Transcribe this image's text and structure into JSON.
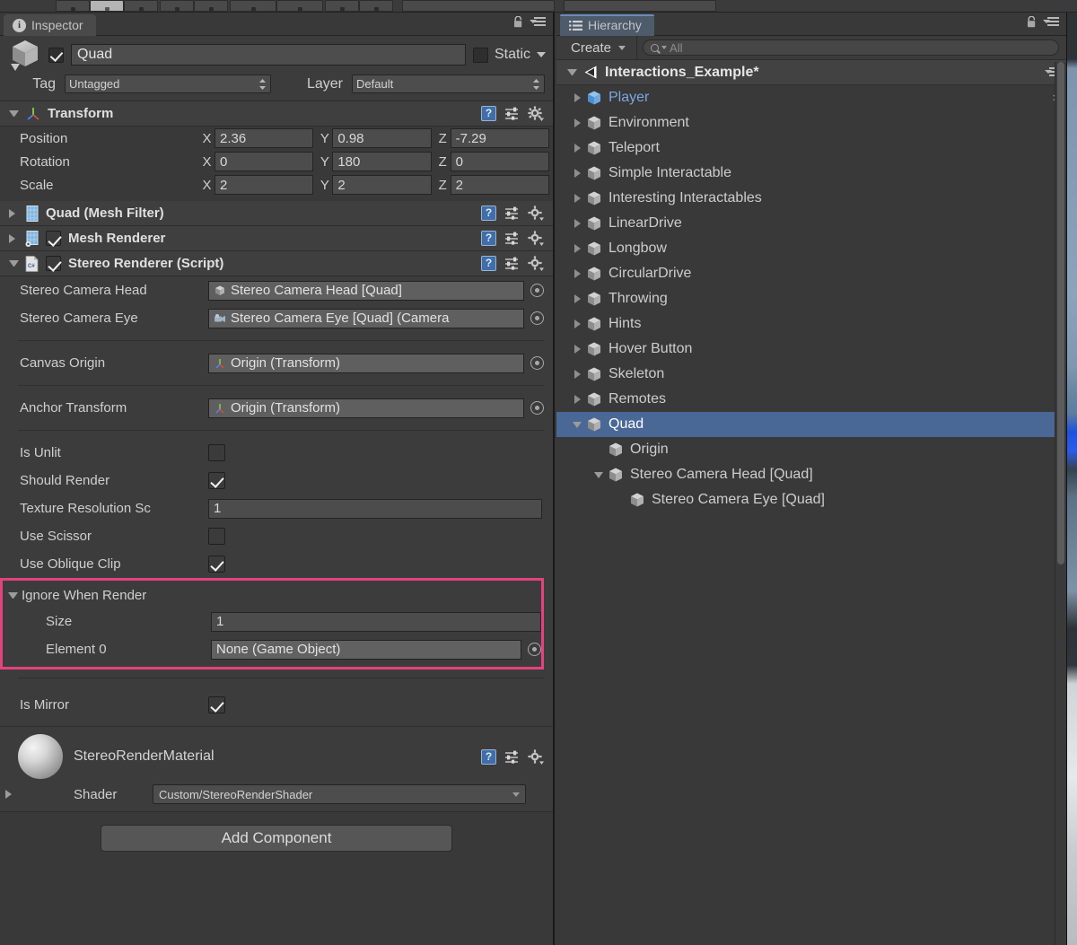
{
  "toolbar": {
    "buttons": [
      "hand-tool",
      "move-tool",
      "rotate-tool",
      "scale-tool",
      "rect-tool",
      "transform-tool",
      "pivot-toggle",
      "local-toggle"
    ]
  },
  "inspector": {
    "tab_label": "Inspector",
    "tab_icon": "info-icon",
    "lock_icon": "lock-icon",
    "menu_icon": "hamburger-menu-icon",
    "object": {
      "icon": "game-object-cube-icon",
      "enabled": true,
      "name": "Quad",
      "static_label": "Static",
      "static_checked": false,
      "tag_label": "Tag",
      "tag_value": "Untagged",
      "layer_label": "Layer",
      "layer_value": "Default"
    },
    "components": [
      {
        "id": "transform",
        "title": "Transform",
        "icon": "transform-axis-icon",
        "expanded": true,
        "rows": [
          {
            "label": "Position",
            "x": "2.36",
            "y": "0.98",
            "z": "-7.29"
          },
          {
            "label": "Rotation",
            "x": "0",
            "y": "180",
            "z": "0"
          },
          {
            "label": "Scale",
            "x": "2",
            "y": "2",
            "z": "2"
          }
        ],
        "axis_labels": [
          "X",
          "Y",
          "Z"
        ]
      },
      {
        "id": "mesh-filter",
        "title": "Quad (Mesh Filter)",
        "icon": "mesh-filter-icon",
        "expanded": false,
        "has_enable_checkbox": false
      },
      {
        "id": "mesh-renderer",
        "title": "Mesh Renderer",
        "icon": "mesh-renderer-icon",
        "expanded": false,
        "has_enable_checkbox": true,
        "enabled": true
      },
      {
        "id": "stereo-renderer",
        "title": "Stereo Renderer (Script)",
        "icon": "csharp-script-icon",
        "expanded": true,
        "has_enable_checkbox": true,
        "enabled": true
      }
    ],
    "header_icons": [
      "help-icon",
      "preset-icon",
      "gear-icon"
    ],
    "stereo_renderer": {
      "object_fields": [
        {
          "label": "Stereo Camera Head",
          "value": "Stereo Camera Head [Quad]",
          "icon": "game-object-icon"
        },
        {
          "label": "Stereo Camera Eye",
          "value": "Stereo Camera Eye [Quad] (Camera",
          "icon": "camera-icon"
        },
        {
          "label": "Canvas Origin",
          "value": "Origin (Transform)",
          "icon": "transform-axis-icon"
        },
        {
          "label": "Anchor Transform",
          "value": "Origin (Transform)",
          "icon": "transform-axis-icon"
        }
      ],
      "bools": [
        {
          "label": "Is Unlit",
          "checked": false
        },
        {
          "label": "Should Render",
          "checked": true
        }
      ],
      "texture_res": {
        "label": "Texture Resolution Sc",
        "value": "1"
      },
      "bools2": [
        {
          "label": "Use Scissor",
          "checked": false
        },
        {
          "label": "Use Oblique Clip",
          "checked": true
        }
      ],
      "array": {
        "label": "Ignore When Render",
        "expanded": true,
        "size_label": "Size",
        "size_value": "1",
        "element_label": "Element 0",
        "element_value": "None (Game Object)",
        "highlight_color": "#e3437c"
      },
      "is_mirror": {
        "label": "Is Mirror",
        "checked": true
      }
    },
    "material": {
      "name": "StereoRenderMaterial",
      "shader_label": "Shader",
      "shader_value": "Custom/StereoRenderShader",
      "preview_icon": "material-sphere-preview"
    },
    "add_component_label": "Add Component"
  },
  "hierarchy": {
    "tab_label": "Hierarchy",
    "tab_icon": "hierarchy-list-icon",
    "lock_icon": "lock-icon",
    "menu_icon": "hamburger-menu-icon",
    "create_label": "Create",
    "search_placeholder": "All",
    "search_icon": "search-icon",
    "scene": {
      "name": "Interactions_Example*",
      "icon": "unity-scene-icon",
      "expanded": true,
      "menu_icon": "scene-context-menu-icon"
    },
    "items": [
      {
        "label": "Player",
        "depth": 1,
        "fold": "closed",
        "icon": "prefab-cube-icon",
        "prefab": true,
        "selected": false,
        "has_arrow": true
      },
      {
        "label": "Environment",
        "depth": 1,
        "fold": "closed",
        "icon": "game-object-icon",
        "prefab": false,
        "selected": false,
        "has_arrow": false
      },
      {
        "label": "Teleport",
        "depth": 1,
        "fold": "closed",
        "icon": "game-object-icon",
        "prefab": false,
        "selected": false,
        "has_arrow": false
      },
      {
        "label": "Simple Interactable",
        "depth": 1,
        "fold": "closed",
        "icon": "game-object-icon",
        "prefab": false,
        "selected": false,
        "has_arrow": false
      },
      {
        "label": "Interesting Interactables",
        "depth": 1,
        "fold": "closed",
        "icon": "game-object-icon",
        "prefab": false,
        "selected": false,
        "has_arrow": false
      },
      {
        "label": "LinearDrive",
        "depth": 1,
        "fold": "closed",
        "icon": "game-object-icon",
        "prefab": false,
        "selected": false,
        "has_arrow": false
      },
      {
        "label": "Longbow",
        "depth": 1,
        "fold": "closed",
        "icon": "game-object-icon",
        "prefab": false,
        "selected": false,
        "has_arrow": false
      },
      {
        "label": "CircularDrive",
        "depth": 1,
        "fold": "closed",
        "icon": "game-object-icon",
        "prefab": false,
        "selected": false,
        "has_arrow": false
      },
      {
        "label": "Throwing",
        "depth": 1,
        "fold": "closed",
        "icon": "game-object-icon",
        "prefab": false,
        "selected": false,
        "has_arrow": false
      },
      {
        "label": "Hints",
        "depth": 1,
        "fold": "closed",
        "icon": "game-object-icon",
        "prefab": false,
        "selected": false,
        "has_arrow": false
      },
      {
        "label": "Hover Button",
        "depth": 1,
        "fold": "closed",
        "icon": "game-object-icon",
        "prefab": false,
        "selected": false,
        "has_arrow": false
      },
      {
        "label": "Skeleton",
        "depth": 1,
        "fold": "closed",
        "icon": "game-object-icon",
        "prefab": false,
        "selected": false,
        "has_arrow": false
      },
      {
        "label": "Remotes",
        "depth": 1,
        "fold": "closed",
        "icon": "game-object-icon",
        "prefab": false,
        "selected": false,
        "has_arrow": false
      },
      {
        "label": "Quad",
        "depth": 1,
        "fold": "open",
        "icon": "game-object-icon",
        "prefab": false,
        "selected": true,
        "has_arrow": false
      },
      {
        "label": "Origin",
        "depth": 2,
        "fold": "none",
        "icon": "game-object-icon",
        "prefab": false,
        "selected": false,
        "has_arrow": false
      },
      {
        "label": "Stereo Camera Head [Quad]",
        "depth": 2,
        "fold": "open",
        "icon": "game-object-icon",
        "prefab": false,
        "selected": false,
        "has_arrow": false
      },
      {
        "label": "Stereo Camera Eye [Quad]",
        "depth": 3,
        "fold": "none",
        "icon": "game-object-icon",
        "prefab": false,
        "selected": false,
        "has_arrow": false
      }
    ]
  },
  "colors": {
    "panel_bg": "#393939",
    "selection_blue": "#4a6896",
    "highlight_pink": "#e3437c",
    "prefab_blue": "#7ba7e0"
  }
}
